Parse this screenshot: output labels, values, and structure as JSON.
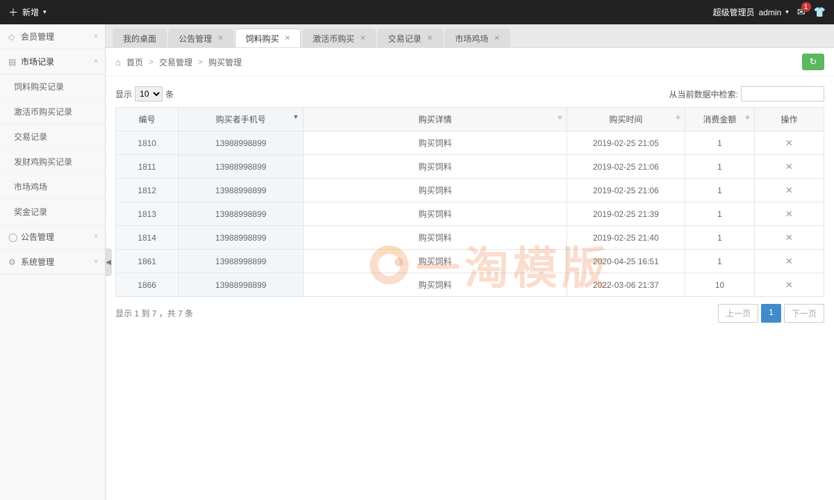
{
  "topbar": {
    "add_label": "新增",
    "role_label": "超级管理员",
    "user_label": "admin",
    "mail_badge": "1"
  },
  "sidebar": {
    "groups": [
      {
        "id": "member",
        "icon": "user",
        "label": "会员管理",
        "expanded": false
      },
      {
        "id": "market",
        "icon": "doc",
        "label": "市场记录",
        "expanded": true
      },
      {
        "id": "notice",
        "icon": "circle",
        "label": "公告管理",
        "expanded": false
      },
      {
        "id": "system",
        "icon": "gear",
        "label": "系统管理",
        "expanded": false
      }
    ],
    "market_items": [
      "饲料购买记录",
      "激活币购买记录",
      "交易记录",
      "发财鸡购买记录",
      "市场鸡场",
      "奖金记录"
    ]
  },
  "tabs": [
    {
      "label": "我的桌面",
      "closable": false,
      "active": false
    },
    {
      "label": "公告管理",
      "closable": true,
      "active": false
    },
    {
      "label": "饲料购买",
      "closable": true,
      "active": true
    },
    {
      "label": "激活币购买",
      "closable": true,
      "active": false
    },
    {
      "label": "交易记录",
      "closable": true,
      "active": false
    },
    {
      "label": "市场鸡场",
      "closable": true,
      "active": false
    }
  ],
  "breadcrumb": [
    "首页",
    "交易管理",
    "购买管理"
  ],
  "table": {
    "show_prefix": "显示",
    "show_suffix": "条",
    "page_size": "10",
    "search_label": "从当前数据中检索:",
    "search_value": "",
    "headers": {
      "id": "编号",
      "phone": "购买者手机号",
      "detail": "购买详情",
      "time": "购买时间",
      "amount": "消费金额",
      "action": "操作"
    },
    "rows": [
      {
        "id": "1810",
        "phone": "13988998899",
        "detail": "购买饲料",
        "time": "2019-02-25 21:05",
        "amount": "1"
      },
      {
        "id": "1811",
        "phone": "13988998899",
        "detail": "购买饲料",
        "time": "2019-02-25 21:06",
        "amount": "1"
      },
      {
        "id": "1812",
        "phone": "13988998899",
        "detail": "购买饲料",
        "time": "2019-02-25 21:06",
        "amount": "1"
      },
      {
        "id": "1813",
        "phone": "13988998899",
        "detail": "购买饲料",
        "time": "2019-02-25 21:39",
        "amount": "1"
      },
      {
        "id": "1814",
        "phone": "13988998899",
        "detail": "购买饲料",
        "time": "2019-02-25 21:40",
        "amount": "1"
      },
      {
        "id": "1861",
        "phone": "13988998899",
        "detail": "购买饲料",
        "time": "2020-04-25 16:51",
        "amount": "1"
      },
      {
        "id": "1866",
        "phone": "13988998899",
        "detail": "购买饲料",
        "time": "2022-03-06 21:37",
        "amount": "10"
      }
    ],
    "info": "显示 1 到 7 ，共 7 条",
    "pagination": {
      "prev": "上一页",
      "next": "下一页",
      "pages": [
        "1"
      ],
      "active": 0
    }
  },
  "watermark": "一淘模版"
}
